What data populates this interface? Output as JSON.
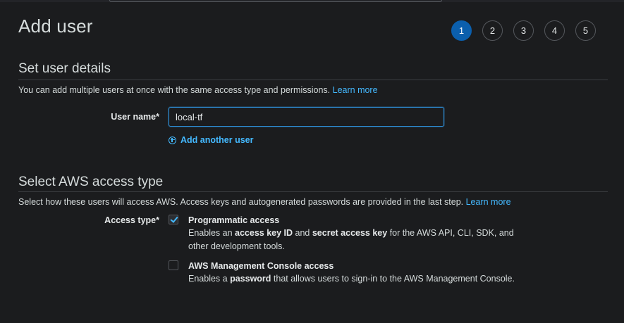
{
  "page": {
    "title": "Add user"
  },
  "steps": [
    "1",
    "2",
    "3",
    "4",
    "5"
  ],
  "active_step": "1",
  "user_details": {
    "title": "Set user details",
    "description": "You can add multiple users at once with the same access type and permissions.",
    "learn_more": "Learn more",
    "user_name_label": "User name*",
    "user_name_value": "local-tf",
    "add_another_user": "Add another user"
  },
  "access_type": {
    "title": "Select AWS access type",
    "description": "Select how these users will access AWS. Access keys and autogenerated passwords are provided in the last step.",
    "learn_more": "Learn more",
    "label": "Access type*",
    "options": [
      {
        "title": "Programmatic access",
        "checked": true,
        "desc_parts": [
          "Enables an ",
          "access key ID",
          " and ",
          "secret access key",
          " for the AWS API, CLI, SDK, and",
          "other development tools."
        ]
      },
      {
        "title": "AWS Management Console access",
        "checked": false,
        "desc_parts": [
          "Enables a ",
          "password",
          " that allows users to sign-in to the AWS Management Console."
        ]
      }
    ]
  },
  "colors": {
    "background": "#1b1c1e",
    "accent": "#0b5fad",
    "link": "#44b9ff",
    "input_border": "#2e8fd8"
  }
}
